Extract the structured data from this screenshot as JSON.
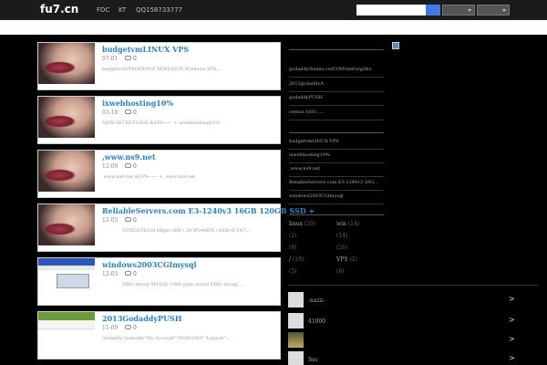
{
  "header": {
    "logo": "fu7.cn",
    "nav": [
      "FDC",
      "KT",
      "QQ158733777"
    ]
  },
  "posts": [
    {
      "title": "budgetvmLINUX VPS",
      "date": "07-01",
      "comments": "0",
      "excerpt": "budgetvmVPSOPENVZ XENLINUX Windows VPS...",
      "thumb": "lips-icon"
    },
    {
      "title": "ixwebhosting10%",
      "date": "03-18",
      "comments": "0",
      "excerpt": "NEW-SECRET-LINK &VPS—— + ixwebhosting10%",
      "thumb": "lips-icon"
    },
    {
      "title": ",www.ns9.net",
      "date": "12-09",
      "comments": "0",
      "excerpt": ",www.ns9.net &VPS—— + ,www.ns9.net",
      "thumb": "lips-icon"
    },
    {
      "title": "ReliableServers.com E3-1240v3 16GB 120GB SSD +",
      "date": "12-05",
      "comments": "0",
      "excerpt": "10TB20TB100 Mbps+BW / 29 IPv44IPS / 64IPv6 24/7...",
      "thumb": "lips-icon"
    },
    {
      "title": "windows2003CGImysql",
      "date": "12-05",
      "comments": "0",
      "excerpt": "DBD::mysql MYSQL CMD ppm install DBD::mysql ...",
      "thumb": "screenshot-icon"
    },
    {
      "title": "2013GodaddyPUSH",
      "date": "11-09",
      "comments": "0",
      "excerpt": "Godaddy Godaddy\"My Account\"\"DOMAINS\"\"Launch\"...",
      "thumb": "screenshot-icon"
    }
  ],
  "sidebar": {
    "links_a": [
      "godaddy/hedao.cn/COM/net/org/mo",
      "2013godaddyA",
      "godaddyPUSH",
      "centos SSH......"
    ],
    "links_b": [
      "budgetvmLINUX VPS",
      "ixwebhosting10%",
      ",www.ns9.net",
      "ReliableServers.com E3-1240v3 16G...",
      "windows2003CGImysql"
    ],
    "categories": [
      {
        "name": "linux",
        "count": "(20)"
      },
      {
        "name": "win",
        "count": "(14)"
      },
      {
        "name": "",
        "count": "(1)"
      },
      {
        "name": "",
        "count": "(14)"
      },
      {
        "name": "",
        "count": "(8)"
      },
      {
        "name": "",
        "count": "(26)"
      },
      {
        "name": "/",
        "count": "(19)"
      },
      {
        "name": "VPS",
        "count": "(2)"
      },
      {
        "name": "",
        "count": "(5)"
      },
      {
        "name": "",
        "count": "(6)"
      }
    ],
    "users": [
      {
        "name": "-nazz-",
        "arrow": ">"
      },
      {
        "name": "41000",
        "arrow": ">"
      },
      {
        "name": "",
        "arrow": ">"
      },
      {
        "name": "Sec",
        "arrow": ">"
      }
    ]
  },
  "colors": {
    "title_link": "#2a82c8",
    "search_button": "#3d7be5"
  }
}
